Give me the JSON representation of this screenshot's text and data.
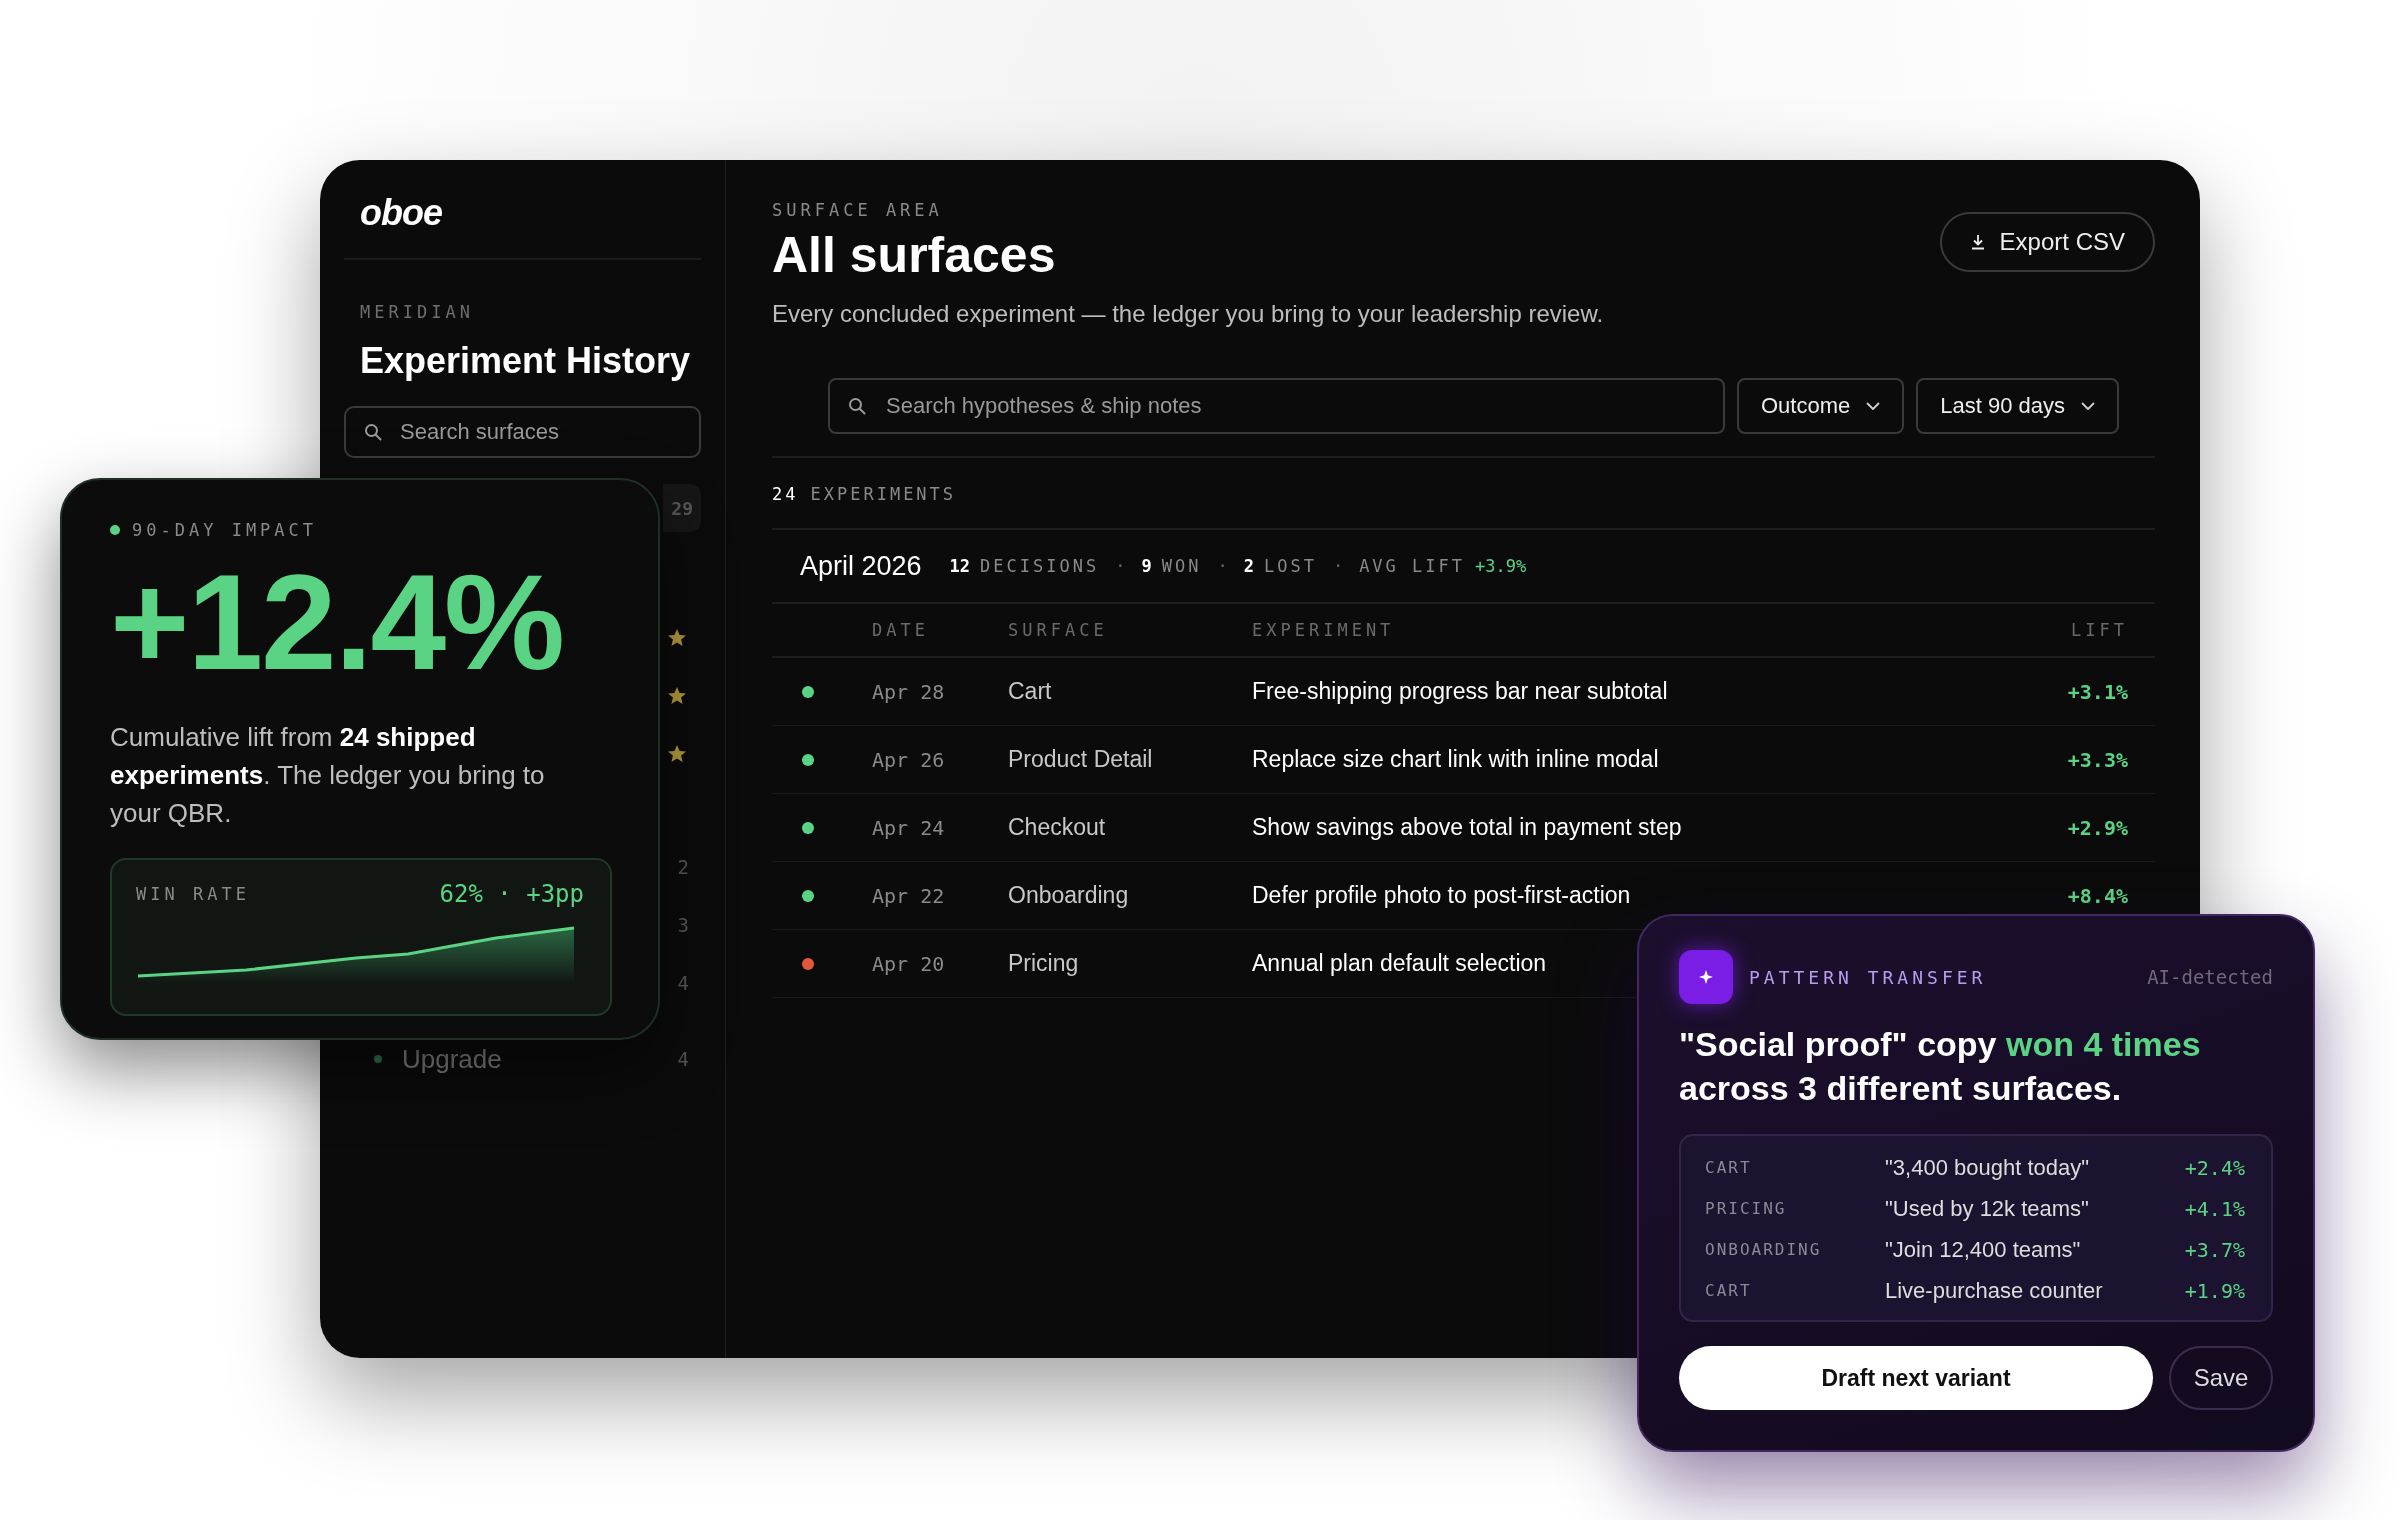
{
  "sidebar": {
    "logo": "oboe",
    "eyebrow": "MERIDIAN",
    "title": "Experiment History",
    "search": {
      "placeholder": "Search surfaces"
    },
    "rows": [
      {
        "kind": "badge",
        "count": "29"
      },
      {
        "kind": "starred"
      },
      {
        "kind": "starred"
      },
      {
        "kind": "starred"
      },
      {
        "kind": "count",
        "count": "2"
      },
      {
        "kind": "count",
        "count": "3"
      },
      {
        "kind": "count",
        "count": "4"
      },
      {
        "kind": "count",
        "count": "4",
        "label": "Upgrade"
      }
    ]
  },
  "header": {
    "eyebrow": "SURFACE AREA",
    "title": "All surfaces",
    "subtitle": "Every concluded experiment — the ledger you bring to your leadership review.",
    "export_button": "Export CSV"
  },
  "filters": {
    "search": {
      "placeholder": "Search hypotheses & ship notes"
    },
    "dropdowns": [
      "Outcome",
      "Last 90 days"
    ]
  },
  "summary": {
    "count": "24",
    "label": "EXPERIMENTS"
  },
  "group": {
    "title": "April 2026",
    "separator": "·",
    "stats": [
      {
        "kind": "count",
        "value": "12",
        "label": "DECISIONS"
      },
      {
        "kind": "count",
        "value": "9",
        "label": "WON"
      },
      {
        "kind": "count",
        "value": "2",
        "label": "LOST"
      },
      {
        "kind": "lift",
        "label": "AVG LIFT",
        "value": "+3.9%"
      }
    ]
  },
  "table": {
    "columns": [
      "DATE",
      "SURFACE",
      "EXPERIMENT",
      "LIFT"
    ],
    "rows": [
      {
        "color": "#5ad484",
        "date": "Apr 28",
        "surface": "Cart",
        "experiment": "Free-shipping progress bar near subtotal",
        "lift": "+3.1%"
      },
      {
        "color": "#5ad484",
        "date": "Apr 26",
        "surface": "Product Detail",
        "experiment": "Replace size chart link with inline modal",
        "lift": "+3.3%"
      },
      {
        "color": "#5ad484",
        "date": "Apr 24",
        "surface": "Checkout",
        "experiment": "Show savings above total in payment step",
        "lift": "+2.9%"
      },
      {
        "color": "#5ad484",
        "date": "Apr 22",
        "surface": "Onboarding",
        "experiment": "Defer profile photo to post-first-action",
        "lift": "+8.4%"
      },
      {
        "color": "#e5573a",
        "date": "Apr 20",
        "surface": "Pricing",
        "experiment": "Annual plan default selection"
      }
    ]
  },
  "impact_card": {
    "label": "90-DAY IMPACT",
    "value": "+12.4%",
    "description": "Cumulative lift from **24 shipped experiments**. The ledger you bring to your QBR.",
    "win_rate": {
      "label": "WIN RATE",
      "value": "62% · +3pp"
    }
  },
  "pattern_card": {
    "label": "PATTERN TRANSFER",
    "tag": "AI-detected",
    "headline": "\"Social proof\" copy **won 4 times** across 3 different surfaces.",
    "rows": [
      {
        "surface": "CART",
        "copy": "\"3,400 bought today\"",
        "lift": "+2.4%"
      },
      {
        "surface": "PRICING",
        "copy": "\"Used by 12k teams\"",
        "lift": "+4.1%"
      },
      {
        "surface": "ONBOARDING",
        "copy": "\"Join 12,400 teams\"",
        "lift": "+3.7%"
      },
      {
        "surface": "CART",
        "copy": "Live-purchase counter",
        "lift": "+1.9%"
      }
    ],
    "primary_button": "Draft next variant",
    "secondary_button": "Save"
  }
}
